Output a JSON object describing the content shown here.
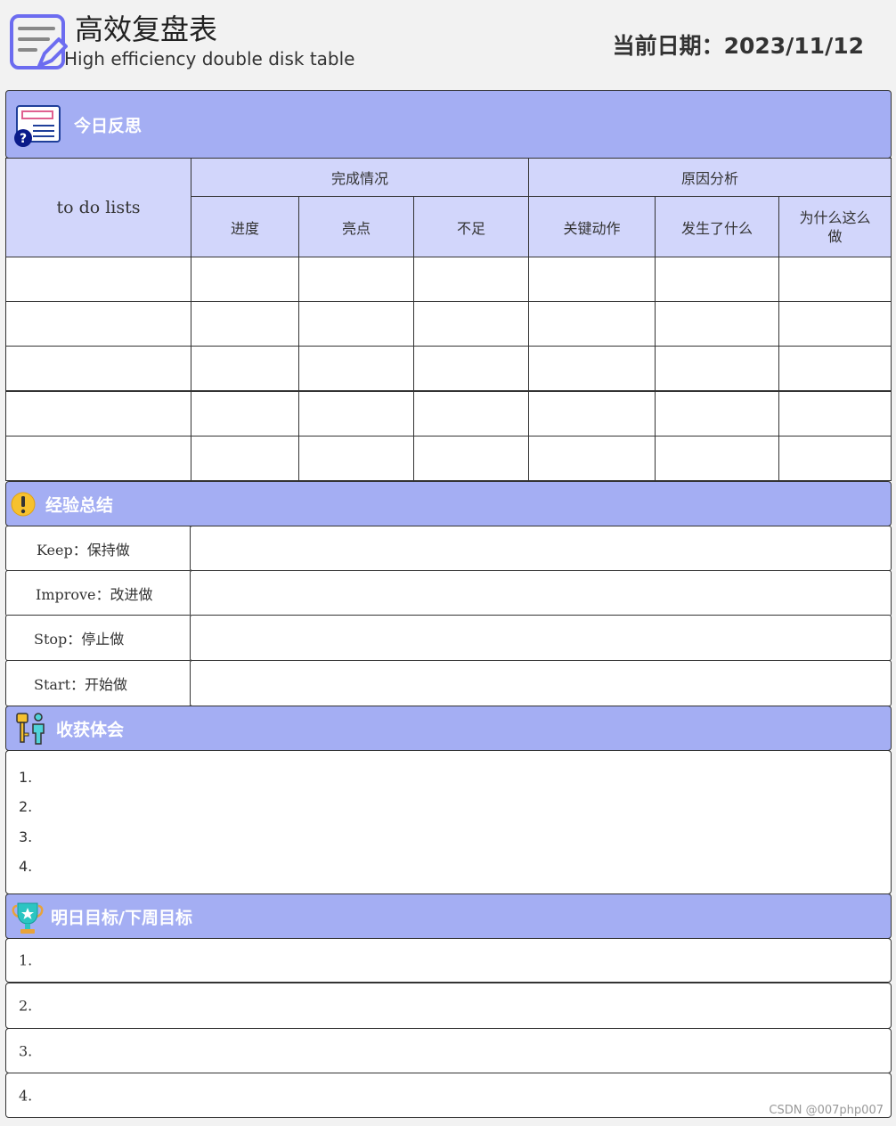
{
  "header": {
    "title": "高效复盘表",
    "subtitle": "High efficiency double disk table",
    "date": "当前日期：2023/11/12"
  },
  "reflection": {
    "title": "今日反思",
    "todo_header": "to do lists",
    "completion_header": "完成情况",
    "reason_header": "原因分析",
    "columns": [
      "进度",
      "亮点",
      "不足",
      "关键动作",
      "发生了什么",
      "为什么这么做"
    ],
    "rows": 5
  },
  "experience": {
    "title": "经验总结",
    "items": [
      "Keep：保持做",
      "Improve：改进做",
      "Stop：停止做",
      "Start：开始做"
    ]
  },
  "harvest": {
    "title": "收获体会",
    "items": [
      "1.",
      "2.",
      "3.",
      "4."
    ]
  },
  "goals": {
    "title": "明日目标/下周目标",
    "items": [
      "1.",
      "2.",
      "3.",
      "4."
    ]
  },
  "watermark": "CSDN @007php007",
  "colors": {
    "section_bg": "#a4aef3",
    "header_cell_bg": "#d2d6fb"
  }
}
